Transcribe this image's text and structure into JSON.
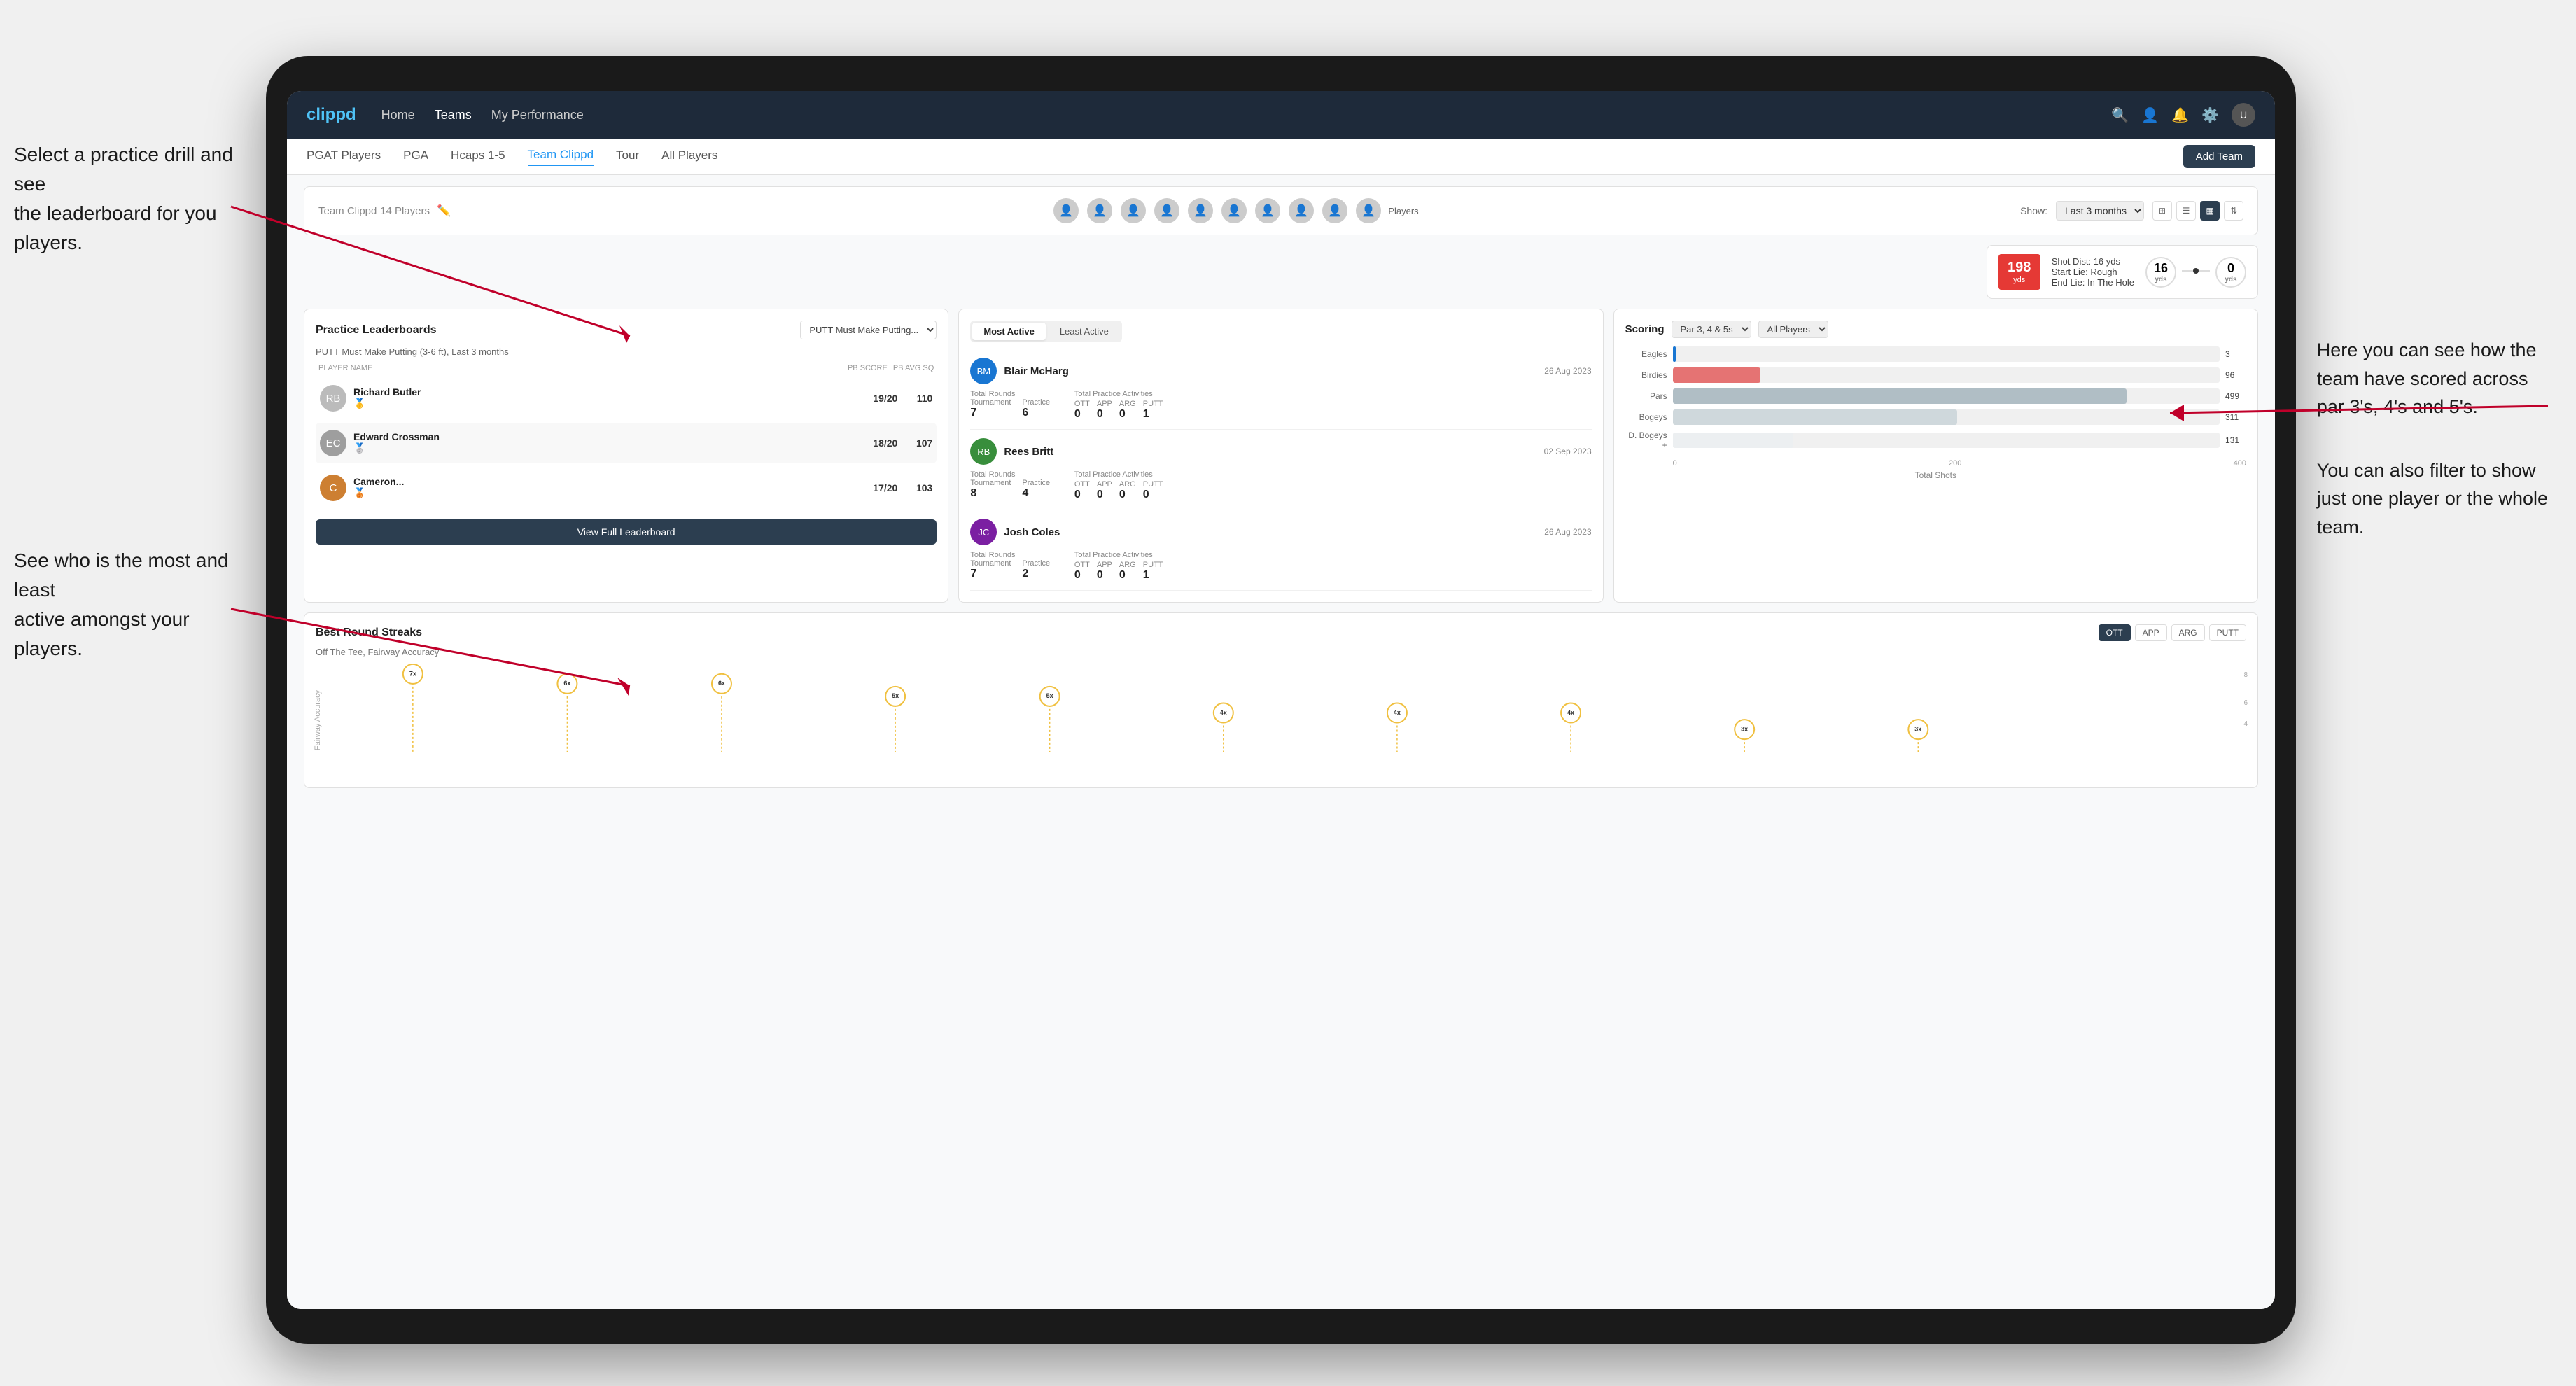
{
  "annotations": {
    "top_left": "Select a practice drill and see\nthe leaderboard for you players.",
    "bottom_left": "See who is the most and least\nactive amongst your players.",
    "right_top": "Here you can see how the\nteam have scored across\npar 3's, 4's and 5's.",
    "right_bottom": "You can also filter to show\njust one player or the whole\nteam."
  },
  "navbar": {
    "logo": "clippd",
    "links": [
      "Home",
      "Teams",
      "My Performance"
    ],
    "active_link": "Teams"
  },
  "sub_nav": {
    "links": [
      "PGAT Players",
      "PGA",
      "Hcaps 1-5",
      "Team Clippd",
      "Tour",
      "All Players"
    ],
    "active": "Team Clippd",
    "add_team": "Add Team"
  },
  "team_header": {
    "title": "Team Clippd",
    "count": "14 Players",
    "show_label": "Show:",
    "period": "Last 3 months",
    "players_label": "Players"
  },
  "shot_card": {
    "dist": "198",
    "dist_unit": "yds",
    "shot_dist_label": "Shot Dist: 16 yds",
    "start_lie": "Start Lie: Rough",
    "end_lie": "End Lie: In The Hole",
    "left_yds": "16",
    "right_yds": "0"
  },
  "practice_leaderboards": {
    "title": "Practice Leaderboards",
    "drill": "PUTT Must Make Putting...",
    "subtitle": "PUTT Must Make Putting (3-6 ft), Last 3 months",
    "col_player": "PLAYER NAME",
    "col_score": "PB SCORE",
    "col_avg": "PB AVG SQ",
    "players": [
      {
        "rank": 1,
        "name": "Richard Butler",
        "medal": "🥇",
        "score": "19/20",
        "avg": "110"
      },
      {
        "rank": 2,
        "name": "Edward Crossman",
        "medal": "🥈",
        "score": "18/20",
        "avg": "107"
      },
      {
        "rank": 3,
        "name": "Cameron...",
        "medal": "🥉",
        "score": "17/20",
        "avg": "103"
      }
    ],
    "view_full_btn": "View Full Leaderboard"
  },
  "activity": {
    "tab_most_active": "Most Active",
    "tab_least_active": "Least Active",
    "active_tab": "Most Active",
    "players": [
      {
        "name": "Blair McHarg",
        "date": "26 Aug 2023",
        "total_rounds_label": "Total Rounds",
        "tournament": "7",
        "practice": "6",
        "practice_label": "Practice",
        "total_practice_label": "Total Practice Activities",
        "ott": "0",
        "app": "0",
        "arg": "0",
        "putt": "1"
      },
      {
        "name": "Rees Britt",
        "date": "02 Sep 2023",
        "total_rounds_label": "Total Rounds",
        "tournament": "8",
        "practice": "4",
        "practice_label": "Practice",
        "total_practice_label": "Total Practice Activities",
        "ott": "0",
        "app": "0",
        "arg": "0",
        "putt": "0"
      },
      {
        "name": "Josh Coles",
        "date": "26 Aug 2023",
        "total_rounds_label": "Total Rounds",
        "tournament": "7",
        "practice": "2",
        "practice_label": "Practice",
        "total_practice_label": "Total Practice Activities",
        "ott": "0",
        "app": "0",
        "arg": "0",
        "putt": "1"
      }
    ]
  },
  "scoring": {
    "title": "Scoring",
    "filter1": "Par 3, 4 & 5s",
    "filter2": "All Players",
    "bars": [
      {
        "label": "Eagles",
        "value": 3,
        "max": 600,
        "color": "#1976d2"
      },
      {
        "label": "Birdies",
        "value": 96,
        "max": 600,
        "color": "#e57373"
      },
      {
        "label": "Pars",
        "value": 499,
        "max": 600,
        "color": "#e0e0e0"
      },
      {
        "label": "Bogeys",
        "value": 311,
        "max": 600,
        "color": "#e0e0e0"
      },
      {
        "label": "D. Bogeys +",
        "value": 131,
        "max": 600,
        "color": "#e0e0e0"
      }
    ],
    "axis_labels": [
      "0",
      "200",
      "400"
    ],
    "total_shots_label": "Total Shots"
  },
  "streaks": {
    "title": "Best Round Streaks",
    "subtitle": "Off The Tee, Fairway Accuracy",
    "filters": [
      "OTT",
      "APP",
      "ARG",
      "PUTT"
    ],
    "active_filter": "OTT",
    "points": [
      {
        "x": 8,
        "label": "7x"
      },
      {
        "x": 18,
        "label": "6x"
      },
      {
        "x": 27,
        "label": "6x"
      },
      {
        "x": 37,
        "label": "5x"
      },
      {
        "x": 46,
        "label": "5x"
      },
      {
        "x": 56,
        "label": "4x"
      },
      {
        "x": 64,
        "label": "4x"
      },
      {
        "x": 73,
        "label": "4x"
      },
      {
        "x": 82,
        "label": "3x"
      },
      {
        "x": 91,
        "label": "3x"
      }
    ]
  }
}
